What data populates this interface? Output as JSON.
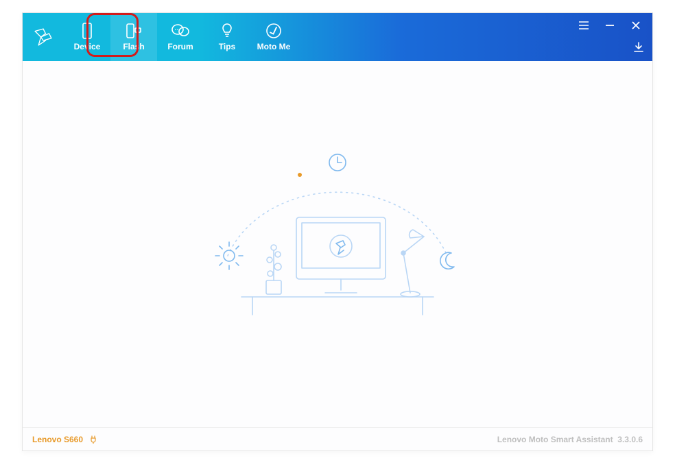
{
  "nav": {
    "items": [
      {
        "label": "Device"
      },
      {
        "label": "Flash"
      },
      {
        "label": "Forum"
      },
      {
        "label": "Tips"
      },
      {
        "label": "Moto Me"
      }
    ],
    "active_index": 1
  },
  "status": {
    "device_model": "Lenovo S660",
    "app_name": "Lenovo Moto Smart Assistant",
    "version": "3.3.0.6"
  },
  "colors": {
    "accent": "#e89a2a",
    "titlebar_left": "#12b9de",
    "titlebar_right": "#1952c7",
    "highlight_ring": "#d21b1b",
    "illus_stroke": "#b9d6f5"
  }
}
